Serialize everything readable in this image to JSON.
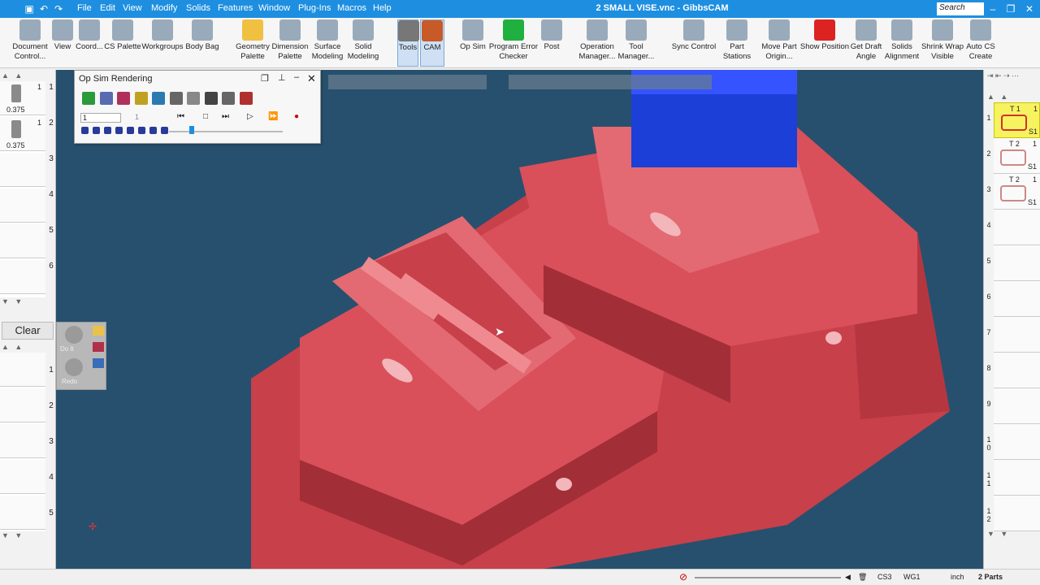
{
  "window": {
    "title": "2 SMALL VISE.vnc - GibbsCAM",
    "search_placeholder": "Search"
  },
  "menu": [
    "File",
    "Edit",
    "View",
    "Modify",
    "Solids",
    "Features",
    "Window",
    "Plug-Ins",
    "Macros",
    "Help"
  ],
  "ribbon": [
    {
      "label": "Document Control...",
      "icon": "document-icon"
    },
    {
      "label": "View",
      "icon": "view-gear-icon"
    },
    {
      "label": "Coord...",
      "icon": "coordinate-icon"
    },
    {
      "label": "CS Palette",
      "icon": "cs-palette-icon"
    },
    {
      "label": "Workgroups",
      "icon": "workgroups-icon"
    },
    {
      "label": "Body Bag",
      "icon": "body-bag-icon"
    },
    {
      "label": "Geometry Palette",
      "icon": "geometry-icon"
    },
    {
      "label": "Dimension Palette",
      "icon": "dimension-icon"
    },
    {
      "label": "Surface Modeling",
      "icon": "surface-icon"
    },
    {
      "label": "Solid Modeling",
      "icon": "solid-icon"
    },
    {
      "label": "Tools",
      "icon": "tools-icon"
    },
    {
      "label": "CAM",
      "icon": "cam-icon"
    },
    {
      "label": "Op Sim",
      "icon": "op-sim-icon"
    },
    {
      "label": "Program Error Checker",
      "icon": "checkmark-icon"
    },
    {
      "label": "Post",
      "icon": "post-icon"
    },
    {
      "label": "Operation Manager...",
      "icon": "operation-manager-icon"
    },
    {
      "label": "Tool Manager...",
      "icon": "tool-manager-icon"
    },
    {
      "label": "Sync Control",
      "icon": "sync-icon"
    },
    {
      "label": "Part Stations",
      "icon": "part-stations-icon"
    },
    {
      "label": "Move Part Origin...",
      "icon": "move-origin-icon"
    },
    {
      "label": "Show Position",
      "icon": "crosshair-icon"
    },
    {
      "label": "Get Draft Angle",
      "icon": "draft-icon"
    },
    {
      "label": "Solids Alignment",
      "icon": "alignment-icon"
    },
    {
      "label": "Shrink Wrap Visible",
      "icon": "shrink-wrap-icon"
    },
    {
      "label": "Auto CS Create",
      "icon": "auto-cs-icon"
    }
  ],
  "left_tools": [
    {
      "num": "1",
      "sub": "1",
      "size": "0.375"
    },
    {
      "num": "2",
      "sub": "1",
      "size": "0.375"
    },
    {
      "num": "3"
    },
    {
      "num": "4"
    },
    {
      "num": "5"
    },
    {
      "num": "6"
    }
  ],
  "clear_label": "Clear",
  "do_it": "Do It",
  "redo": "Redo",
  "left_ops": [
    "1",
    "2",
    "3",
    "4",
    "5"
  ],
  "opsim": {
    "title": "Op Sim Rendering",
    "step_value": "1",
    "count_value": "1"
  },
  "right_ops": [
    {
      "num": "1",
      "tool": "T 1",
      "count": "1",
      "station": "S1"
    },
    {
      "num": "2",
      "tool": "T 2",
      "count": "1",
      "station": "S1"
    },
    {
      "num": "3",
      "tool": "T 2",
      "count": "1",
      "station": "S1"
    },
    {
      "num": "4"
    },
    {
      "num": "5"
    },
    {
      "num": "6"
    },
    {
      "num": "7"
    },
    {
      "num": "8"
    },
    {
      "num": "9"
    },
    {
      "num": "1\n0"
    },
    {
      "num": "1\n1"
    },
    {
      "num": "1\n2"
    }
  ],
  "status": {
    "cs": "CS3",
    "wg": "WG1",
    "units": "inch",
    "parts": "2 Parts"
  },
  "colors": {
    "accent": "#1e8fe0",
    "part": "#d9505a",
    "viewport": "#27506e",
    "fixture": "#1c3fd8"
  }
}
